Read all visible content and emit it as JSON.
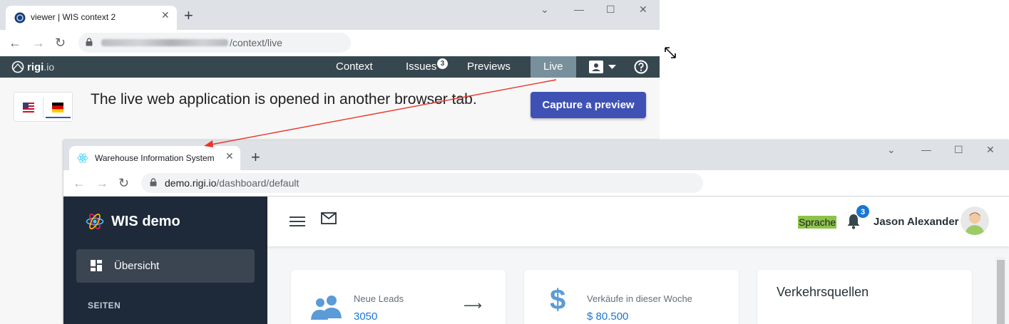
{
  "viewer_window": {
    "tab_title": "viewer | WIS context 2",
    "url_path": "/context/live",
    "nav": {
      "context": "Context",
      "issues": "Issues",
      "issues_badge": "3",
      "previews": "Previews",
      "live": "Live"
    },
    "logo_text": "rigi",
    "logo_suffix": ".io",
    "live_message": "The live web application is opened in another browser tab.",
    "capture_button": "Capture a preview",
    "accent_color": "#3f51b5"
  },
  "app_window": {
    "tab_title": "Warehouse Information System",
    "url_host": "demo.rigi.io",
    "url_path": "/dashboard/default",
    "sidebar": {
      "brand": "WIS demo",
      "active_item": "Übersicht",
      "section_label": "SEITEN"
    },
    "topbar": {
      "language_label": "Sprache",
      "notifications_count": "3",
      "user_name": "Jason Alexander"
    },
    "cards": [
      {
        "label": "Neue Leads",
        "value": "3050",
        "icon": "people-icon"
      },
      {
        "label": "Verkäufe in dieser Woche",
        "value": "$ 80.500",
        "icon": "dollar-icon"
      },
      {
        "title": "Verkehrsquellen"
      }
    ]
  }
}
